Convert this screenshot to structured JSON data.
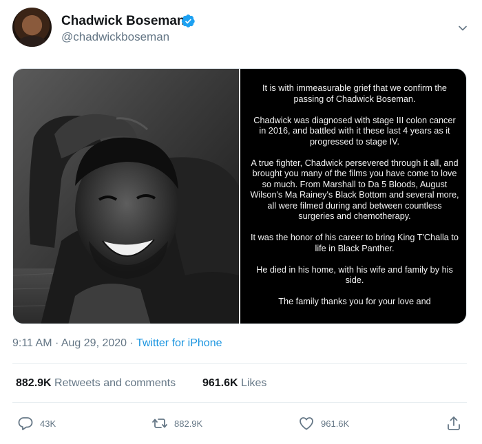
{
  "user": {
    "display_name": "Chadwick Boseman",
    "handle": "@chadwickboseman",
    "verified": true
  },
  "statement": {
    "paragraphs": [
      "It is with immeasurable grief that we confirm the passing of Chadwick Boseman.",
      "Chadwick was diagnosed with stage III colon cancer in 2016, and battled with it these last 4 years as it progressed to stage IV.",
      "A true fighter, Chadwick persevered through it all, and brought you many of the films you have come to love so much. From Marshall to Da 5 Bloods, August Wilson's Ma Rainey's Black Bottom and several more, all were filmed during and between countless surgeries and chemotherapy.",
      "It was the honor of his career to bring King T'Challa to life in Black Panther.",
      "He died in his home, with his wife and family by his side.",
      "The family thanks you for your love and"
    ]
  },
  "meta": {
    "time": "9:11 AM",
    "separator": "·",
    "date": "Aug 29, 2020",
    "source": "Twitter for iPhone"
  },
  "stats": {
    "retweets_count": "882.9K",
    "retweets_label": "Retweets and comments",
    "likes_count": "961.6K",
    "likes_label": "Likes"
  },
  "actions": {
    "reply_count": "43K",
    "retweet_count": "882.9K",
    "like_count": "961.6K"
  },
  "colors": {
    "link": "#1b95e0",
    "secondary_text": "#657786",
    "verified_badge": "#1da1f2"
  },
  "icons": [
    "verified-badge-icon",
    "chevron-down-icon",
    "reply-icon",
    "retweet-icon",
    "like-icon",
    "share-icon"
  ]
}
